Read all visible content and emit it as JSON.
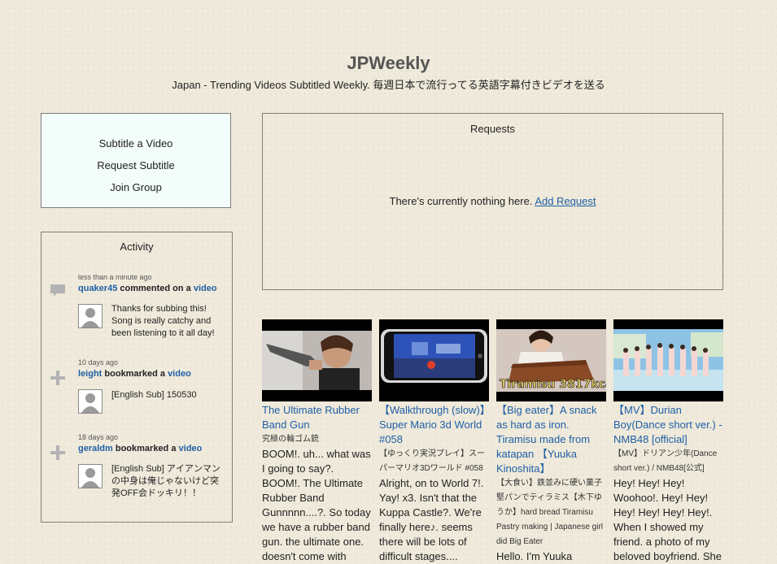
{
  "site": {
    "title": "JPWeekly",
    "tagline": "Japan - Trending Videos Subtitled Weekly. 毎週日本で流行ってる英語字幕付きビデオを送る"
  },
  "menu": {
    "subtitle_video": "Subtitle a Video",
    "request_subtitle": "Request Subtitle",
    "join_group": "Join Group"
  },
  "activity": {
    "title": "Activity",
    "items": [
      {
        "time": "less than a minute ago",
        "user": "quaker45",
        "action": "commented on a",
        "target": "video",
        "icon": "comment-icon",
        "message": "Thanks for subbing this! Song is really catchy and been listening to it all day!"
      },
      {
        "time": "10 days ago",
        "user": "leight",
        "action": "bookmarked a",
        "target": "video",
        "icon": "plus-icon",
        "message": "[English Sub] 150530"
      },
      {
        "time": "18 days ago",
        "user": "geraldm",
        "action": "bookmarked a",
        "target": "video",
        "icon": "plus-icon",
        "message": "[English Sub] アイアンマンの中身は俺じゃないけど突発OFF会ドッキリ！！"
      }
    ]
  },
  "requests": {
    "title": "Requests",
    "empty_text": "There's currently nothing here.",
    "add_link": "Add Request"
  },
  "videos": [
    {
      "title": "The Ultimate Rubber Band Gun",
      "subtitle": "究極の輪ゴム銃",
      "description": "BOOM!. uh... what was I going to say?. BOOM!. The Ultimate Rubber Band Gunnnnn....?. So today we have a rubber band gun. the ultimate one. doesn't come with"
    },
    {
      "title": "【Walkthrough (slow)】Super Mario 3d World #058",
      "subtitle": "【ゆっくり実況プレイ】スーパーマリオ3Dワールド #058",
      "description": "Alright, on to World 7!. Yay! x3. Isn't that the Kuppa Castle?. We're finally here♪. seems there will be lots of difficult stages...."
    },
    {
      "title": "【Big eater】A snack as hard as iron. Tiramisu made from katapan 【Yuuka Kinoshita】",
      "subtitle": "【大食い】鉄並みに硬い菓子　堅パンでティラミス【木下ゆうか】hard bread Tiramisu Pastry making | Japanese girl did Big Eater",
      "description": "Hello. I'm Yuuka"
    },
    {
      "title": "【MV】Durian Boy(Dance short ver.) - NMB48 [official]",
      "subtitle": "【MV】ドリアン少年(Dance short ver.) / NMB48[公式]",
      "description": "Hey! Hey! Hey! Woohoo!. Hey! Hey! Hey! Hey! Hey! Hey!. When I showed my friend. a photo of my beloved boyfriend. She"
    }
  ],
  "thumb_overlay_text": "Tiramisu 3817kcal"
}
